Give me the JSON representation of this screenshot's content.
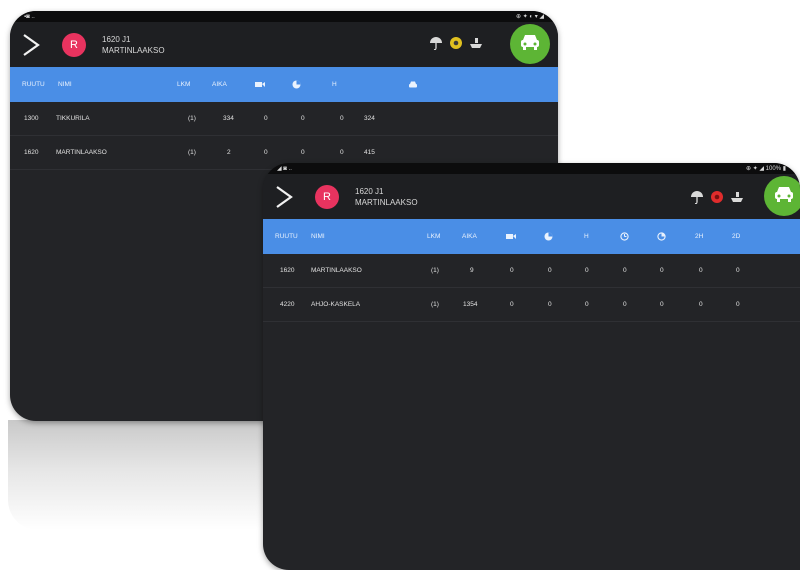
{
  "back": {
    "status": {
      "left": "▪◙ ..",
      "right": "⊕ ✦ ◐ ▾ ◢"
    },
    "header": {
      "route": "1620 J1",
      "stop": "MARTINLAAKSO",
      "avatar": "R"
    },
    "columns": [
      "RUUTU",
      "NIMI",
      "LKM",
      "AIKA",
      "H"
    ],
    "rows": [
      {
        "id": "1300",
        "name": "TIKKURILA",
        "lkm": "(1)",
        "aika": "334",
        "c1": "0",
        "c2": "0",
        "c3": "0",
        "c4": "324"
      },
      {
        "id": "1620",
        "name": "MARTINLAAKSO",
        "lkm": "(1)",
        "aika": "2",
        "c1": "0",
        "c2": "0",
        "c3": "0",
        "c4": "415"
      }
    ]
  },
  "front": {
    "status": {
      "left": "◢ ◙ ..",
      "right": "⊕ ✦ ◢ 100% ▮"
    },
    "header": {
      "route": "1620 J1",
      "stop": "MARTINLAAKSO",
      "avatar": "R"
    },
    "columns": [
      "RUUTU",
      "NIMI",
      "LKM",
      "AIKA",
      "H",
      "2H",
      "2D"
    ],
    "rows": [
      {
        "id": "1620",
        "name": "MARTINLAAKSO",
        "lkm": "(1)",
        "aika": "9",
        "v": [
          "0",
          "0",
          "0",
          "0",
          "0",
          "0",
          "0"
        ]
      },
      {
        "id": "4220",
        "name": "AHJO-KASKELA",
        "lkm": "(1)",
        "aika": "1354",
        "v": [
          "0",
          "0",
          "0",
          "0",
          "0",
          "0",
          "0"
        ]
      }
    ]
  },
  "colors": {
    "accent": "#4a8ee6",
    "avatar": "#e8335f",
    "car_button": "#5db535",
    "background": "#232427",
    "back_mid_icon": "#e0c020",
    "front_mid_icon": "#e02c2c"
  },
  "icons": [
    "chevron-right-icon",
    "umbrella-icon",
    "status-dot-icon",
    "ship-icon",
    "car-icon",
    "camera-icon",
    "pie-icon",
    "clock-icon",
    "timer-icon"
  ]
}
